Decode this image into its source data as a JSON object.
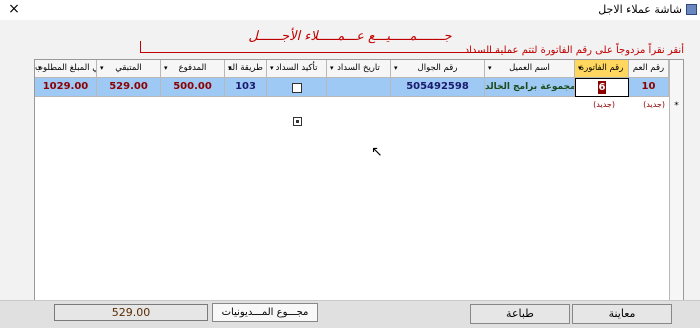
{
  "window": {
    "title": "شاشة عملاء الاجل",
    "icon": "app-icon",
    "close": "×"
  },
  "form": {
    "heading": "جـــــــمـــــيـــع عـــمـــــلاء الأجــــــل",
    "instruction": "أنقر نقراً مزدوجاً على رقم الفاتورة لتتم عملية السداد"
  },
  "grid": {
    "columns": [
      {
        "label": "رقم العم",
        "arrow": ""
      },
      {
        "label": "رقم الفاتورة",
        "arrow": "▾",
        "active": true
      },
      {
        "label": "اسم العميل",
        "arrow": "▾"
      },
      {
        "label": "رقم الجوال",
        "arrow": "▾"
      },
      {
        "label": "تاريخ السداد",
        "arrow": "▾"
      },
      {
        "label": "تأكيد السداد",
        "arrow": "▾"
      },
      {
        "label": "طريقة الد",
        "arrow": "▾"
      },
      {
        "label": "المدفوع",
        "arrow": "▾"
      },
      {
        "label": "المتبقي",
        "arrow": "▾"
      },
      {
        "label": "إجمالي المبلغ المطلوب",
        "arrow": "▾"
      }
    ],
    "rows": [
      {
        "customer_no": "10",
        "invoice_no": "6",
        "customer_name": "مجموعة برامج الخالد",
        "mobile": "505492598",
        "payment_date": "",
        "confirmed": false,
        "payment_method": "103",
        "paid": "500.00",
        "remaining": "529.00",
        "total": "1029.00"
      }
    ],
    "new_row_label_customer": "(جديد)",
    "new_row_label_invoice": "(جديد)",
    "new_row_marker": "*"
  },
  "footer": {
    "total_value": "529.00",
    "total_label": "مجـــوع المـــديونيات",
    "print_label": "طباعة",
    "preview_label": "معاينة"
  }
}
